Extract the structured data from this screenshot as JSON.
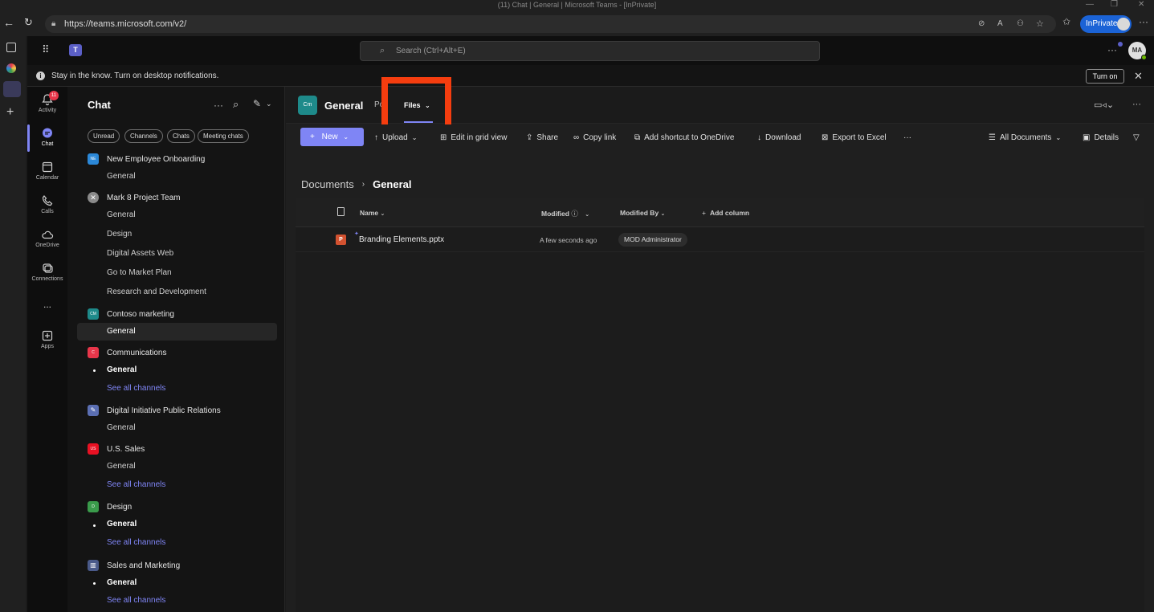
{
  "browser": {
    "window_title": "(11) Chat | General | Microsoft Teams - [InPrivate]",
    "url": "https://teams.microsoft.com/v2/",
    "inprivate_label": "InPrivate"
  },
  "teams_header": {
    "search_placeholder": "Search (Ctrl+Alt+E)",
    "avatar_initials": "MA"
  },
  "notification_bar": {
    "text": "Stay in the know. Turn on desktop notifications.",
    "button_label": "Turn on"
  },
  "rail": {
    "items": [
      {
        "label": "Activity",
        "badge": "11"
      },
      {
        "label": "Chat"
      },
      {
        "label": "Calendar"
      },
      {
        "label": "Calls"
      },
      {
        "label": "OneDrive"
      },
      {
        "label": "Connections"
      },
      {
        "label": "..."
      },
      {
        "label": "Apps"
      }
    ]
  },
  "chat_pane": {
    "title": "Chat",
    "filters": [
      "Unread",
      "Channels",
      "Chats",
      "Meeting chats"
    ],
    "teams": [
      {
        "name": "New Employee Onboarding",
        "avatar": "NE",
        "color": "#2b88d8",
        "channels": [
          {
            "name": "General"
          }
        ]
      },
      {
        "name": "Mark 8 Project Team",
        "avatar": "",
        "color": "#8a8a8a",
        "channels": [
          {
            "name": "General"
          },
          {
            "name": "Design"
          },
          {
            "name": "Digital Assets Web"
          },
          {
            "name": "Go to Market Plan"
          },
          {
            "name": "Research and Development"
          }
        ]
      },
      {
        "name": "Contoso marketing",
        "avatar": "CM",
        "color": "#1e8a8a",
        "channels": [
          {
            "name": "General",
            "selected": true
          }
        ]
      },
      {
        "name": "Communications",
        "avatar": "C",
        "color": "#e8364a",
        "channels": [
          {
            "name": "General",
            "bold": true
          },
          {
            "name": "See all channels",
            "link": true
          }
        ]
      },
      {
        "name": "Digital Initiative Public Relations",
        "avatar": "",
        "color": "#5b6fb3",
        "channels": [
          {
            "name": "General"
          }
        ]
      },
      {
        "name": "U.S. Sales",
        "avatar": "US",
        "color": "#e81123",
        "channels": [
          {
            "name": "General"
          },
          {
            "name": "See all channels",
            "link": true
          }
        ]
      },
      {
        "name": "Design",
        "avatar": "D",
        "color": "#3a9b4b",
        "channels": [
          {
            "name": "General",
            "bold": true
          },
          {
            "name": "See all channels",
            "link": true
          }
        ]
      },
      {
        "name": "Sales and Marketing",
        "avatar": "",
        "color": "#4a5a8a",
        "channels": [
          {
            "name": "General",
            "bold": true
          },
          {
            "name": "See all channels",
            "link": true
          }
        ]
      }
    ]
  },
  "channel_header": {
    "avatar": "Cm",
    "name": "General",
    "tab_posts": "Po",
    "tab_files": "Files"
  },
  "toolbar": {
    "new": "New",
    "upload": "Upload",
    "grid": "Edit in grid view",
    "share": "Share",
    "copy_link": "Copy link",
    "shortcut": "Add shortcut to OneDrive",
    "download": "Download",
    "export": "Export to Excel",
    "more": "···",
    "view": "All Documents",
    "details": "Details"
  },
  "breadcrumb": {
    "root": "Documents",
    "current": "General"
  },
  "file_list": {
    "columns": {
      "name": "Name",
      "modified": "Modified",
      "modified_by": "Modified By",
      "add_column": "Add column"
    },
    "rows": [
      {
        "name": "Branding Elements.pptx",
        "modified": "A few seconds ago",
        "modified_by": "MOD Administrator"
      }
    ]
  }
}
